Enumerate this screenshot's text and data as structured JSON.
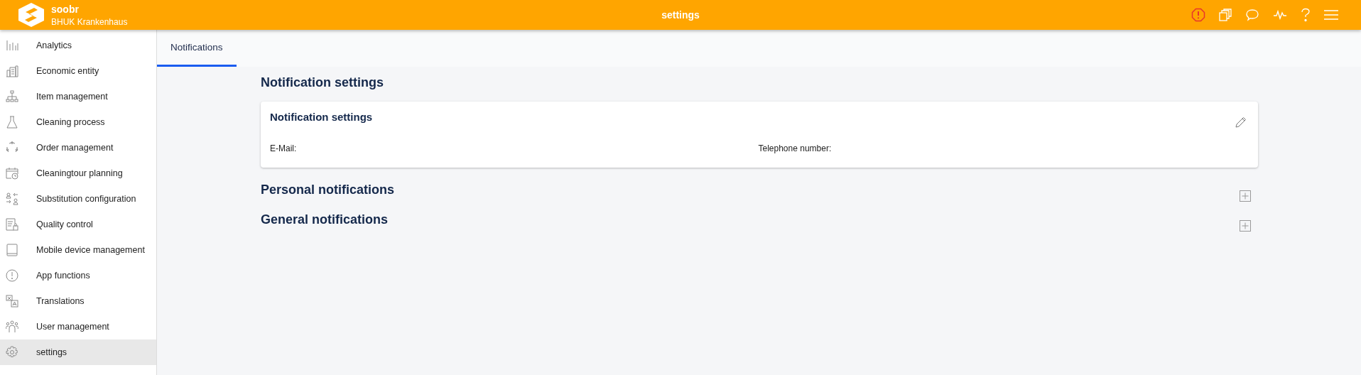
{
  "header": {
    "brand": "soobr",
    "organization": "BHUK Krankenhaus",
    "title": "settings"
  },
  "sidebar": {
    "items": [
      {
        "label": "Analytics",
        "selected": false
      },
      {
        "label": "Economic entity",
        "selected": false
      },
      {
        "label": "Item management",
        "selected": false
      },
      {
        "label": "Cleaning process",
        "selected": false
      },
      {
        "label": "Order management",
        "selected": false
      },
      {
        "label": "Cleaningtour planning",
        "selected": false
      },
      {
        "label": "Substitution configuration",
        "selected": false
      },
      {
        "label": "Quality control",
        "selected": false
      },
      {
        "label": "Mobile device management",
        "selected": false
      },
      {
        "label": "App functions",
        "selected": false
      },
      {
        "label": "Translations",
        "selected": false
      },
      {
        "label": "User management",
        "selected": false
      },
      {
        "label": "settings",
        "selected": true
      }
    ]
  },
  "tabs": [
    {
      "label": "Notifications",
      "selected": true
    }
  ],
  "page_title": "Notification settings",
  "card": {
    "title": "Notification settings",
    "fields": [
      {
        "label": "E-Mail:"
      },
      {
        "label": "Telephone number:"
      }
    ]
  },
  "sections": [
    {
      "title": "Personal notifications"
    },
    {
      "title": "General notifications"
    }
  ]
}
